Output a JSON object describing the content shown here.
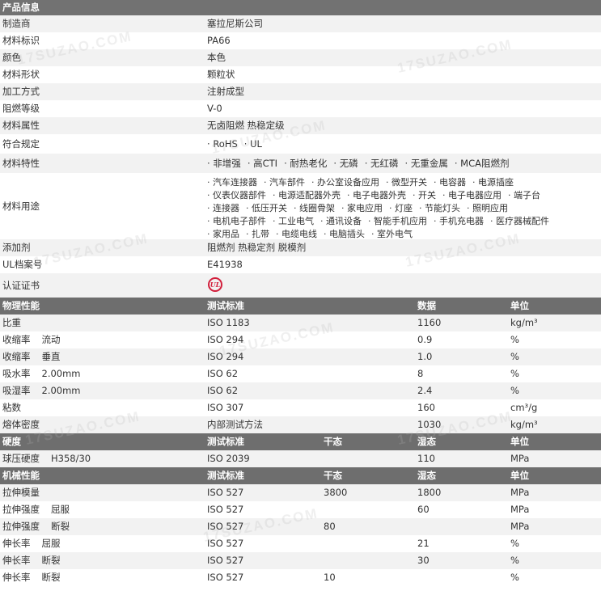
{
  "product": {
    "header": "产品信息",
    "rows": [
      {
        "label": "制造商",
        "value": "塞拉尼斯公司"
      },
      {
        "label": "材料标识",
        "value": "PA66"
      },
      {
        "label": "颜色",
        "value": "本色"
      },
      {
        "label": "材料形状",
        "value": "颗粒状"
      },
      {
        "label": "加工方式",
        "value": "注射成型"
      },
      {
        "label": "阻燃等级",
        "value": "V-0"
      },
      {
        "label": "材料属性",
        "value": "无卤阻燃 热稳定级"
      }
    ],
    "compliance": {
      "label": "符合规定",
      "tags": [
        "RoHS",
        "UL"
      ]
    },
    "features": {
      "label": "材料特性",
      "tags": [
        "非增强",
        "高CTI",
        "耐热老化",
        "无磷",
        "无红磷",
        "无重金属",
        "MCA阻燃剂"
      ]
    },
    "uses": {
      "label": "材料用途",
      "lines": [
        [
          "汽车连接器",
          "汽车部件",
          "办公室设备应用",
          "微型开关",
          "电容器",
          "电源插座"
        ],
        [
          "仪表仪器部件",
          "电源适配器外壳",
          "电子电器外壳",
          "开关",
          "电子电器应用",
          "端子台"
        ],
        [
          "连接器",
          "低压开关",
          "线圈骨架",
          "家电应用",
          "灯座",
          "节能灯头",
          "照明应用"
        ],
        [
          "电机电子部件",
          "工业电气",
          "通讯设备",
          "智能手机应用",
          "手机充电器",
          "医疗器械配件"
        ],
        [
          "家用品",
          "扎带",
          "电缆电线",
          "电脑插头",
          "室外电气"
        ]
      ]
    },
    "additive": {
      "label": "添加剂",
      "value": "阻燃剂 热稳定剂 脱模剂"
    },
    "ul_file": {
      "label": "UL档案号",
      "value": "E41938"
    },
    "cert": {
      "label": "认证证书",
      "logo_text": "UL"
    }
  },
  "physical": {
    "headers": [
      "物理性能",
      "测试标准",
      "",
      "数据",
      "单位"
    ],
    "rows": [
      {
        "name": "比重",
        "sub": "",
        "std": "ISO 1183",
        "dry": "",
        "val": "1160",
        "unit": "kg/m³"
      },
      {
        "name": "收缩率",
        "sub": "流动",
        "std": "ISO 294",
        "dry": "",
        "val": "0.9",
        "unit": "%"
      },
      {
        "name": "收缩率",
        "sub": "垂直",
        "std": "ISO 294",
        "dry": "",
        "val": "1.0",
        "unit": "%"
      },
      {
        "name": "吸水率",
        "sub": "2.00mm",
        "std": "ISO 62",
        "dry": "",
        "val": "8",
        "unit": "%"
      },
      {
        "name": "吸湿率",
        "sub": "2.00mm",
        "std": "ISO 62",
        "dry": "",
        "val": "2.4",
        "unit": "%"
      },
      {
        "name": "粘数",
        "sub": "",
        "std": "ISO 307",
        "dry": "",
        "val": "160",
        "unit": "cm³/g"
      },
      {
        "name": "熔体密度",
        "sub": "",
        "std": "内部测试方法",
        "dry": "",
        "val": "1030",
        "unit": "kg/m³"
      }
    ]
  },
  "hardness": {
    "headers": [
      "硬度",
      "测试标准",
      "干态",
      "湿态",
      "单位"
    ],
    "rows": [
      {
        "name": "球压硬度",
        "sub": "H358/30",
        "std": "ISO 2039",
        "dry": "",
        "val": "110",
        "unit": "MPa"
      }
    ]
  },
  "mechanical": {
    "headers": [
      "机械性能",
      "测试标准",
      "干态",
      "湿态",
      "单位"
    ],
    "rows": [
      {
        "name": "拉伸模量",
        "sub": "",
        "std": "ISO 527",
        "dry": "3800",
        "val": "1800",
        "unit": "MPa"
      },
      {
        "name": "拉伸强度",
        "sub": "屈服",
        "std": "ISO 527",
        "dry": "",
        "val": "60",
        "unit": "MPa"
      },
      {
        "name": "拉伸强度",
        "sub": "断裂",
        "std": "ISO 527",
        "dry": "80",
        "val": "",
        "unit": "MPa"
      },
      {
        "name": "伸长率",
        "sub": "屈服",
        "std": "ISO 527",
        "dry": "",
        "val": "21",
        "unit": "%"
      },
      {
        "name": "伸长率",
        "sub": "断裂",
        "std": "ISO 527",
        "dry": "",
        "val": "30",
        "unit": "%"
      },
      {
        "name": "伸长率",
        "sub": "断裂",
        "std": "ISO 527",
        "dry": "10",
        "val": "",
        "unit": "%"
      }
    ]
  },
  "watermark": "17SUZAO.COM"
}
